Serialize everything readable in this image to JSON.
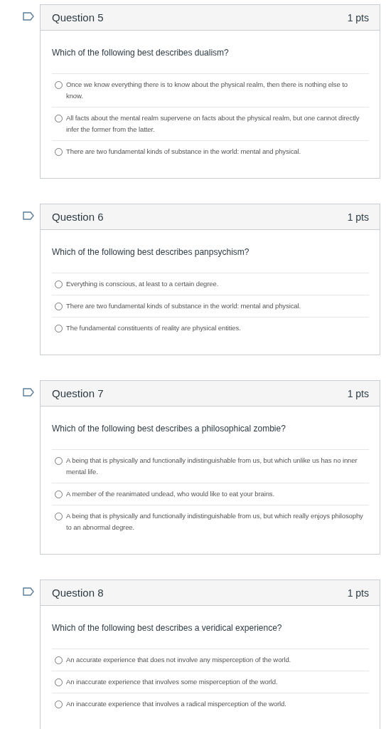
{
  "questions": [
    {
      "title": "Question 5",
      "points": "1 pts",
      "prompt": "Which of the following best describes dualism?",
      "options": [
        {
          "text": "Once we know everything there is to know about the physical realm, then there is nothing else to know.",
          "selected": false
        },
        {
          "text": "All facts about the mental realm supervene on facts about the physical realm, but one cannot directly infer the former from the latter.",
          "selected": false
        },
        {
          "text": "There are two fundamental kinds of substance in the world: mental and physical.",
          "selected": false
        }
      ]
    },
    {
      "title": "Question 6",
      "points": "1 pts",
      "prompt": "Which of the following best describes panpsychism?",
      "options": [
        {
          "text": "Everything is conscious, at least to a certain degree.",
          "selected": false
        },
        {
          "text": "There are two fundamental kinds of substance in the world: mental and physical.",
          "selected": false
        },
        {
          "text": "The fundamental constituents of reality are physical entities.",
          "selected": false
        }
      ]
    },
    {
      "title": "Question 7",
      "points": "1 pts",
      "prompt": "Which of the following best describes a philosophical zombie?",
      "options": [
        {
          "text": "A being that is physically and functionally indistinguishable from us, but which unlike us has no inner mental life.",
          "selected": false
        },
        {
          "text": "A member of the reanimated undead, who would like to eat your brains.",
          "selected": false
        },
        {
          "text": "A being that is physically and functionally indistinguishable from us, but which really enjoys philosophy to an abnormal degree.",
          "selected": false
        }
      ]
    },
    {
      "title": "Question 8",
      "points": "1 pts",
      "prompt": "Which of the following best describes a veridical experience?",
      "options": [
        {
          "text": "An accurate experience that does not involve any misperception of the world.",
          "selected": false
        },
        {
          "text": "An inaccurate experience that involves some misperception of the world.",
          "selected": false
        },
        {
          "text": "An inaccurate experience that involves a radical misperception of the world.",
          "selected": false
        }
      ]
    }
  ]
}
